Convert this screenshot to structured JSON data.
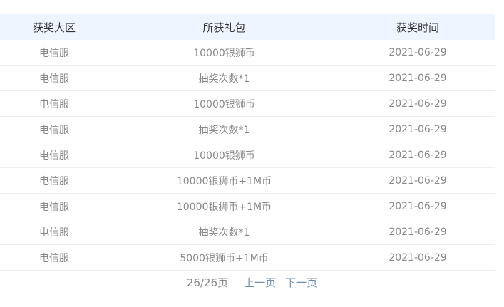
{
  "table": {
    "headers": [
      "获奖大区",
      "所获礼包",
      "获奖时间"
    ],
    "rows": [
      [
        "电信服",
        "10000银狮币",
        "2021-06-29"
      ],
      [
        "电信服",
        "抽奖次数*1",
        "2021-06-29"
      ],
      [
        "电信服",
        "10000银狮币",
        "2021-06-29"
      ],
      [
        "电信服",
        "抽奖次数*1",
        "2021-06-29"
      ],
      [
        "电信服",
        "10000银狮币",
        "2021-06-29"
      ],
      [
        "电信服",
        "10000银狮币+1M币",
        "2021-06-29"
      ],
      [
        "电信服",
        "10000银狮币+1M币",
        "2021-06-29"
      ],
      [
        "电信服",
        "抽奖次数*1",
        "2021-06-29"
      ],
      [
        "电信服",
        "5000银狮币+1M币",
        "2021-06-29"
      ]
    ]
  },
  "pager": {
    "info": "26/26页",
    "prev_label": "上一页",
    "next_label": "下一页"
  }
}
